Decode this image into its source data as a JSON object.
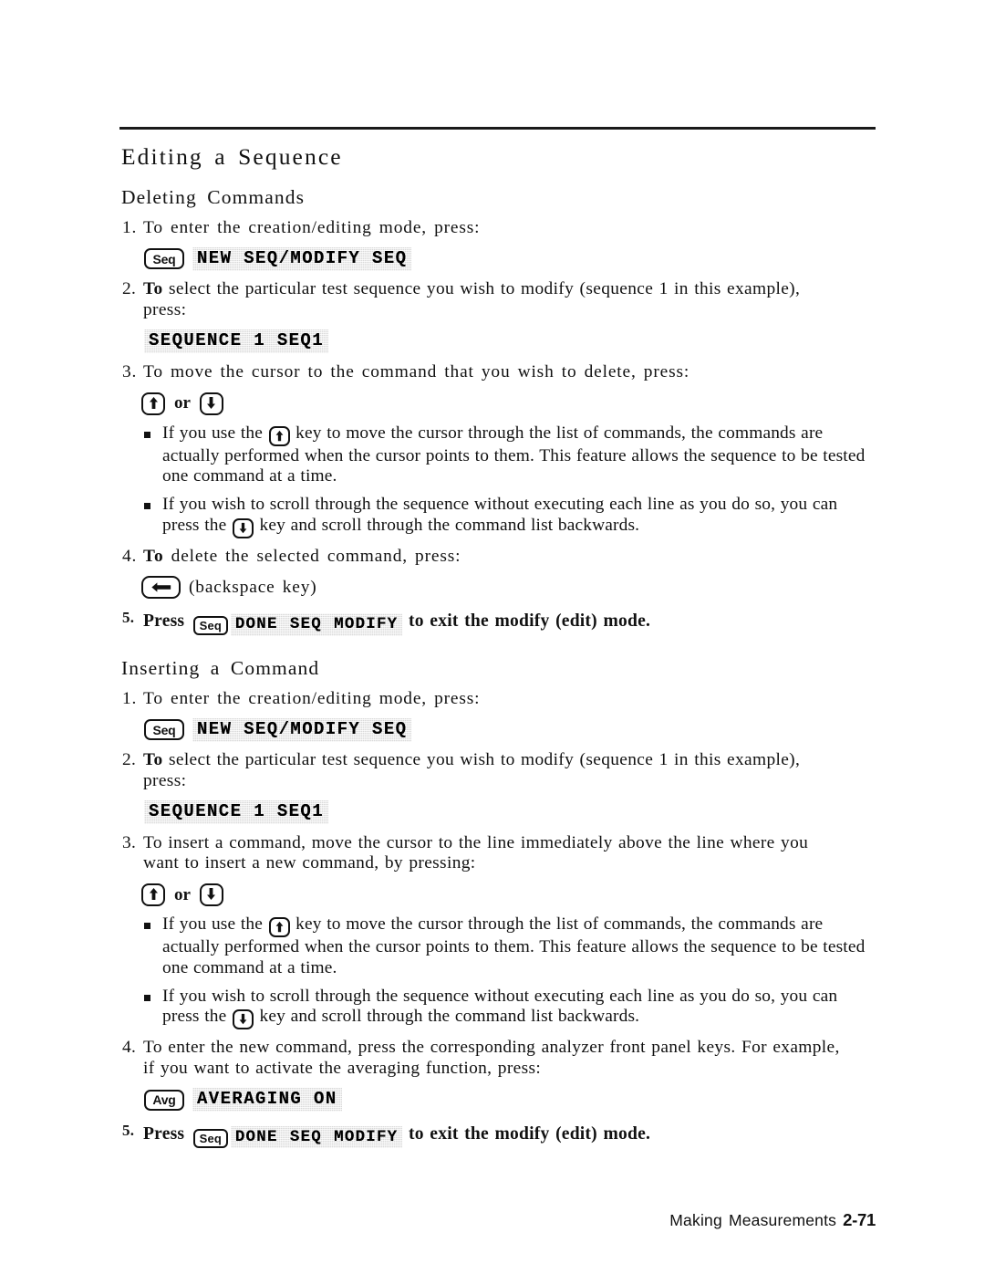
{
  "page": {
    "footer_text": "Making  Measurements",
    "footer_page": "2-71"
  },
  "section_title": "Editing a Sequence",
  "sections": [
    {
      "heading": "Deleting  Commands",
      "step1": {
        "num": "1.",
        "text": "To enter the creation/editing mode, press:",
        "hardkey": "Seq",
        "softkey": "NEW SEQ/MODIFY SEQ"
      },
      "step2": {
        "num": "2.",
        "lead": "To",
        "text": " select the particular test sequence you wish to modify (sequence 1 in this example),",
        "cont": "press:",
        "softkey": "SEQUENCE 1 SEQ1"
      },
      "step3": {
        "num": "3.",
        "text": "To move the cursor to the command that you wish to delete, press:",
        "or_label": "or"
      },
      "bullets": [
        {
          "pre": "If you use the ",
          "icon": "up-arrow-key",
          "post": " key to move the cursor through the list of commands, the commands are actually performed when the cursor points to them. This feature allows the sequence to be tested one command at a time."
        },
        {
          "pre": "If you wish to scroll through the sequence without executing each line as you do so, you can press the ",
          "icon": "down-arrow-key",
          "post": " key and scroll through the command list backwards."
        }
      ],
      "step4": {
        "num": "4.",
        "lead": "To",
        "text": " delete the selected command, press:",
        "key_caption": "(backspace key)"
      },
      "step5": {
        "num": "5.",
        "pre": "Press ",
        "hardkey": "Seq",
        "softkey": "DONE SEQ MODIFY",
        "post": " to exit the modify (edit) mode."
      }
    },
    {
      "heading": "Inserting a Command",
      "step1": {
        "num": "1.",
        "text": "To enter the creation/editing mode, press:",
        "hardkey": "Seq",
        "softkey": "NEW SEQ/MODIFY SEQ"
      },
      "step2": {
        "num": "2.",
        "lead": "To",
        "text": " select the particular test sequence you wish to modify (sequence 1 in this example),",
        "cont": "press:",
        "softkey": "SEQUENCE 1 SEQ1"
      },
      "step3": {
        "num": "3.",
        "text": "To insert a command, move the cursor to the line immediately above the line where you",
        "cont": "want to insert a new command, by pressing:",
        "or_label": "or"
      },
      "bullets": [
        {
          "pre": "If you use the ",
          "icon": "up-arrow-key",
          "post": " key to move the cursor through the list of commands, the commands are actually performed when the cursor points to them. This feature allows the sequence to be tested one command at a time."
        },
        {
          "pre": "If you wish to scroll through the sequence without executing each line as you do so, you can press the ",
          "icon": "down-arrow-key",
          "post": " key and scroll through the command list backwards."
        }
      ],
      "step4": {
        "num": "4.",
        "text": "To enter the new command, press the corresponding analyzer front panel keys. For example,",
        "cont": "if you want to activate the averaging function, press:",
        "hardkey": "Avg",
        "softkey": "AVERAGING ON"
      },
      "step5": {
        "num": "5.",
        "pre": "Press ",
        "hardkey": "Seq",
        "softkey": "DONE SEQ MODIFY",
        "post": " to exit the modify (edit) mode."
      }
    }
  ]
}
